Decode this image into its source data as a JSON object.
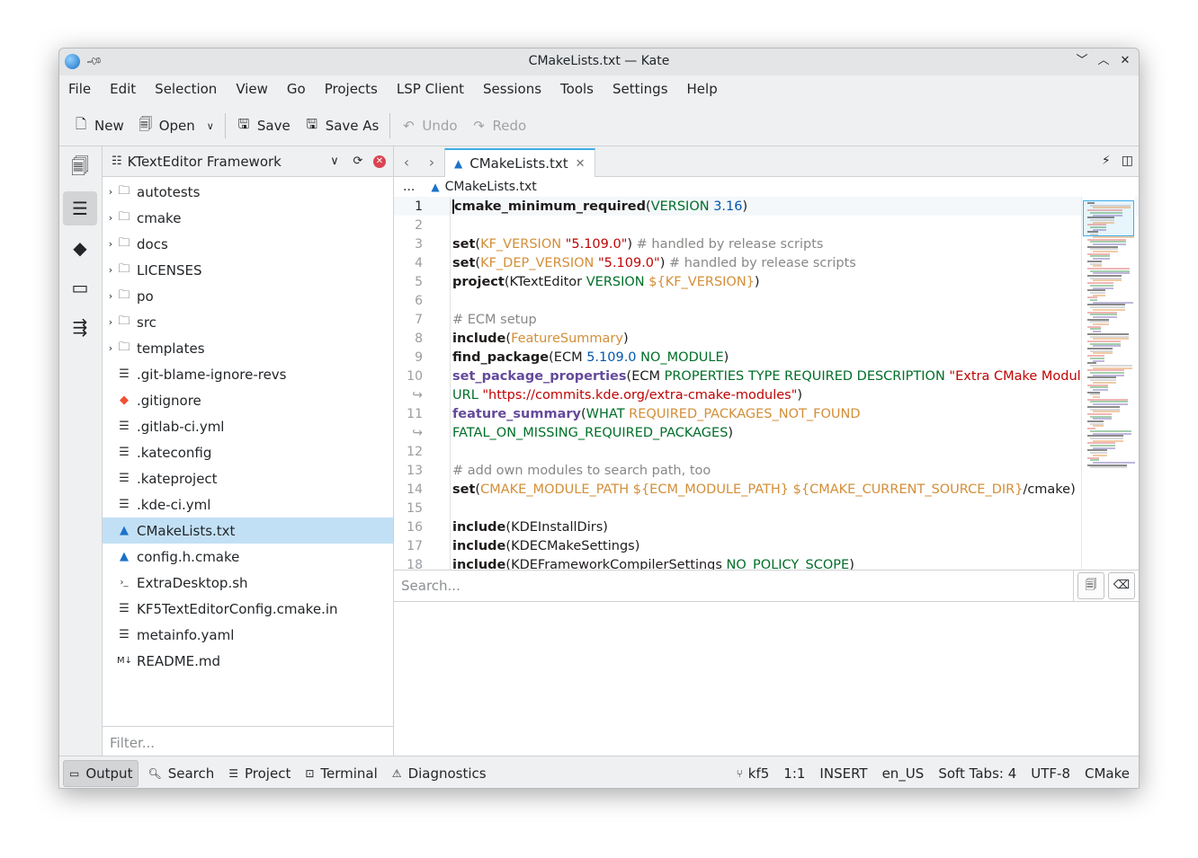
{
  "window": {
    "title": "CMakeLists.txt — Kate"
  },
  "menubar": [
    "File",
    "Edit",
    "Selection",
    "View",
    "Go",
    "Projects",
    "LSP Client",
    "Sessions",
    "Tools",
    "Settings",
    "Help"
  ],
  "toolbar": {
    "new_label": "New",
    "open_label": "Open",
    "save_label": "Save",
    "save_as_label": "Save As",
    "undo_label": "Undo",
    "redo_label": "Redo"
  },
  "project_panel": {
    "title": "KTextEditor Framework",
    "filter_placeholder": "Filter...",
    "items": [
      {
        "name": "autotests",
        "type": "folder"
      },
      {
        "name": "cmake",
        "type": "folder"
      },
      {
        "name": "docs",
        "type": "folder"
      },
      {
        "name": "LICENSES",
        "type": "folder"
      },
      {
        "name": "po",
        "type": "folder"
      },
      {
        "name": "src",
        "type": "folder"
      },
      {
        "name": "templates",
        "type": "folder"
      },
      {
        "name": ".git-blame-ignore-revs",
        "type": "text"
      },
      {
        "name": ".gitignore",
        "type": "git"
      },
      {
        "name": ".gitlab-ci.yml",
        "type": "text"
      },
      {
        "name": ".kateconfig",
        "type": "text"
      },
      {
        "name": ".kateproject",
        "type": "text"
      },
      {
        "name": ".kde-ci.yml",
        "type": "text"
      },
      {
        "name": "CMakeLists.txt",
        "type": "cmake",
        "selected": true
      },
      {
        "name": "config.h.cmake",
        "type": "cmake"
      },
      {
        "name": "ExtraDesktop.sh",
        "type": "shell"
      },
      {
        "name": "KF5TextEditorConfig.cmake.in",
        "type": "text"
      },
      {
        "name": "metainfo.yaml",
        "type": "text"
      },
      {
        "name": "README.md",
        "type": "markdown"
      }
    ]
  },
  "editor": {
    "tab_label": "CMakeLists.txt",
    "breadcrumb_dots": "...",
    "breadcrumb_file": "CMakeLists.txt",
    "lines": [
      {
        "n": "1",
        "current": true,
        "parts": [
          [
            "kw",
            "cmake_minimum_required"
          ],
          [
            "paren",
            "("
          ],
          [
            "param",
            "VERSION "
          ],
          [
            "num",
            "3.16"
          ],
          [
            "paren",
            ")"
          ]
        ]
      },
      {
        "n": "2",
        "parts": []
      },
      {
        "n": "3",
        "parts": [
          [
            "kw",
            "set"
          ],
          [
            "paren",
            "("
          ],
          [
            "var",
            "KF_VERSION"
          ],
          [
            "plain",
            " "
          ],
          [
            "str",
            "\"5.109.0\""
          ],
          [
            "paren",
            ")"
          ],
          [
            "cmt",
            " # handled by release scripts"
          ]
        ]
      },
      {
        "n": "4",
        "parts": [
          [
            "kw",
            "set"
          ],
          [
            "paren",
            "("
          ],
          [
            "var",
            "KF_DEP_VERSION"
          ],
          [
            "plain",
            " "
          ],
          [
            "str",
            "\"5.109.0\""
          ],
          [
            "paren",
            ")"
          ],
          [
            "cmt",
            " # handled by release scripts"
          ]
        ]
      },
      {
        "n": "5",
        "parts": [
          [
            "kw",
            "project"
          ],
          [
            "paren",
            "("
          ],
          [
            "plain",
            "KTextEditor "
          ],
          [
            "param",
            "VERSION "
          ],
          [
            "var",
            "${KF_VERSION}"
          ],
          [
            "paren",
            ")"
          ]
        ]
      },
      {
        "n": "6",
        "parts": []
      },
      {
        "n": "7",
        "parts": [
          [
            "cmt",
            "# ECM setup"
          ]
        ]
      },
      {
        "n": "8",
        "parts": [
          [
            "kw",
            "include"
          ],
          [
            "paren",
            "("
          ],
          [
            "var",
            "FeatureSummary"
          ],
          [
            "paren",
            ")"
          ]
        ]
      },
      {
        "n": "9",
        "parts": [
          [
            "kw",
            "find_package"
          ],
          [
            "paren",
            "("
          ],
          [
            "plain",
            "ECM "
          ],
          [
            "num",
            "5.109.0"
          ],
          [
            "plain",
            "  "
          ],
          [
            "param",
            "NO_MODULE"
          ],
          [
            "paren",
            ")"
          ]
        ]
      },
      {
        "n": "10",
        "parts": [
          [
            "kw2",
            "set_package_properties"
          ],
          [
            "paren",
            "("
          ],
          [
            "plain",
            "ECM "
          ],
          [
            "param",
            "PROPERTIES TYPE REQUIRED DESCRIPTION "
          ],
          [
            "str",
            "\"Extra CMake Modules.\""
          ]
        ]
      },
      {
        "n": "↪",
        "parts": [
          [
            "param",
            "URL "
          ],
          [
            "str",
            "\"https://commits.kde.org/extra-cmake-modules\""
          ],
          [
            "paren",
            ")"
          ]
        ]
      },
      {
        "n": "11",
        "parts": [
          [
            "kw2",
            "feature_summary"
          ],
          [
            "paren",
            "("
          ],
          [
            "param",
            "WHAT "
          ],
          [
            "var",
            "REQUIRED_PACKAGES_NOT_FOUND"
          ]
        ]
      },
      {
        "n": "↪",
        "parts": [
          [
            "param",
            "FATAL_ON_MISSING_REQUIRED_PACKAGES"
          ],
          [
            "paren",
            ")"
          ]
        ]
      },
      {
        "n": "12",
        "parts": []
      },
      {
        "n": "13",
        "parts": [
          [
            "cmt",
            "# add own modules to search path, too"
          ]
        ]
      },
      {
        "n": "14",
        "parts": [
          [
            "kw",
            "set"
          ],
          [
            "paren",
            "("
          ],
          [
            "var",
            "CMAKE_MODULE_PATH"
          ],
          [
            "plain",
            " "
          ],
          [
            "var",
            "${ECM_MODULE_PATH}"
          ],
          [
            "plain",
            " "
          ],
          [
            "var",
            "${CMAKE_CURRENT_SOURCE_DIR}"
          ],
          [
            "plain",
            "/cmake"
          ],
          [
            "paren",
            ")"
          ]
        ]
      },
      {
        "n": "15",
        "parts": []
      },
      {
        "n": "16",
        "parts": [
          [
            "kw",
            "include"
          ],
          [
            "paren",
            "("
          ],
          [
            "plain",
            "KDEInstallDirs"
          ],
          [
            "paren",
            ")"
          ]
        ]
      },
      {
        "n": "17",
        "parts": [
          [
            "kw",
            "include"
          ],
          [
            "paren",
            "("
          ],
          [
            "plain",
            "KDECMakeSettings"
          ],
          [
            "paren",
            ")"
          ]
        ]
      },
      {
        "n": "18",
        "parts": [
          [
            "kw",
            "include"
          ],
          [
            "paren",
            "("
          ],
          [
            "plain",
            "KDEFrameworkCompilerSettings "
          ],
          [
            "param",
            "NO_POLICY_SCOPE"
          ],
          [
            "paren",
            ")"
          ]
        ]
      }
    ]
  },
  "search": {
    "placeholder": "Search..."
  },
  "statusbar": {
    "tabs": [
      {
        "label": "Output",
        "icon": "output-icon",
        "active": true
      },
      {
        "label": "Search",
        "icon": "search-icon"
      },
      {
        "label": "Project",
        "icon": "project-icon"
      },
      {
        "label": "Terminal",
        "icon": "terminal-icon"
      },
      {
        "label": "Diagnostics",
        "icon": "diagnostics-icon"
      }
    ],
    "branch": "kf5",
    "position": "1:1",
    "mode": "INSERT",
    "language_dict": "en_US",
    "indent": "Soft Tabs: 4",
    "encoding": "UTF-8",
    "syntax": "CMake"
  }
}
